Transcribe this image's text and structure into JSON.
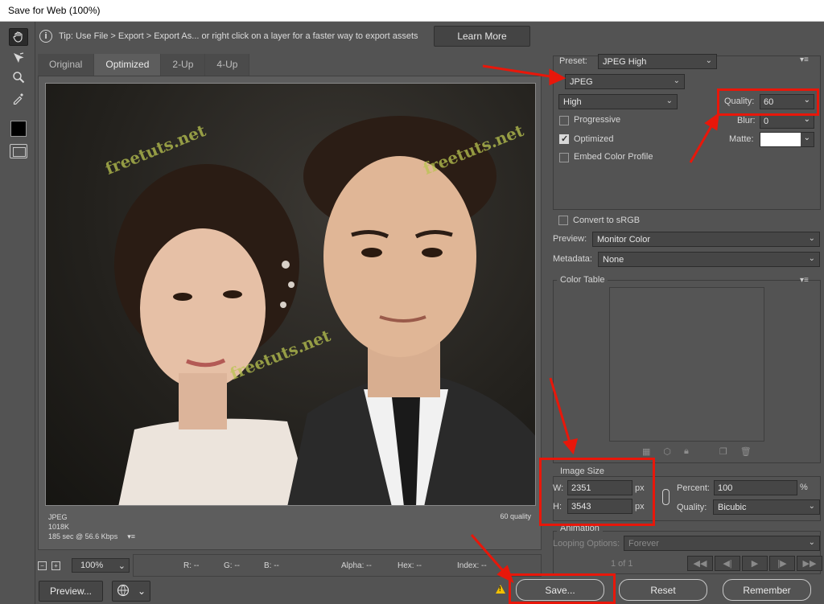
{
  "window": {
    "title": "Save for Web (100%)"
  },
  "tip": {
    "text": "Tip: Use File > Export > Export As...  or right click on a layer for a faster way to export assets",
    "learn_more": "Learn More"
  },
  "tabs": [
    {
      "label": "Original"
    },
    {
      "label": "Optimized"
    },
    {
      "label": "2-Up"
    },
    {
      "label": "4-Up"
    }
  ],
  "preview": {
    "watermark": "freetuts.net",
    "format": "JPEG",
    "filesize": "1018K",
    "timing": "185 sec @ 56.6 Kbps",
    "quality_note": "60 quality"
  },
  "statusbar": {
    "zoom": "100%",
    "r": "R: --",
    "g": "G: --",
    "b": "B: --",
    "alpha": "Alpha: --",
    "hex": "Hex: --",
    "index": "Index: --"
  },
  "buttons": {
    "preview": "Preview...",
    "save": "Save...",
    "reset": "Reset",
    "remember": "Remember"
  },
  "settings": {
    "preset_label": "Preset:",
    "preset_value": "JPEG High",
    "format_value": "JPEG",
    "compression_value": "High",
    "quality_label": "Quality:",
    "quality_value": "60",
    "blur_label": "Blur:",
    "blur_value": "0",
    "matte_label": "Matte:",
    "progressive_label": "Progressive",
    "progressive_checked": false,
    "optimized_label": "Optimized",
    "optimized_checked": true,
    "embed_label": "Embed Color Profile",
    "embed_checked": false,
    "srgb_label": "Convert to sRGB",
    "srgb_checked": false,
    "preview_label": "Preview:",
    "preview_value": "Monitor Color",
    "metadata_label": "Metadata:",
    "metadata_value": "None"
  },
  "color_table": {
    "title": "Color Table"
  },
  "image_size": {
    "title": "Image Size",
    "w_label": "W:",
    "w_value": "2351",
    "h_label": "H:",
    "h_value": "3543",
    "unit": "px",
    "percent_label": "Percent:",
    "percent_value": "100",
    "percent_unit": "%",
    "quality_label": "Quality:",
    "quality_value": "Bicubic"
  },
  "animation": {
    "title": "Animation",
    "looping_label": "Looping Options:",
    "looping_value": "Forever",
    "frame_counter": "1 of 1"
  },
  "colors": {
    "annotation_red": "#e8170a",
    "panel_bg": "#535353",
    "field_bg": "#464646"
  }
}
